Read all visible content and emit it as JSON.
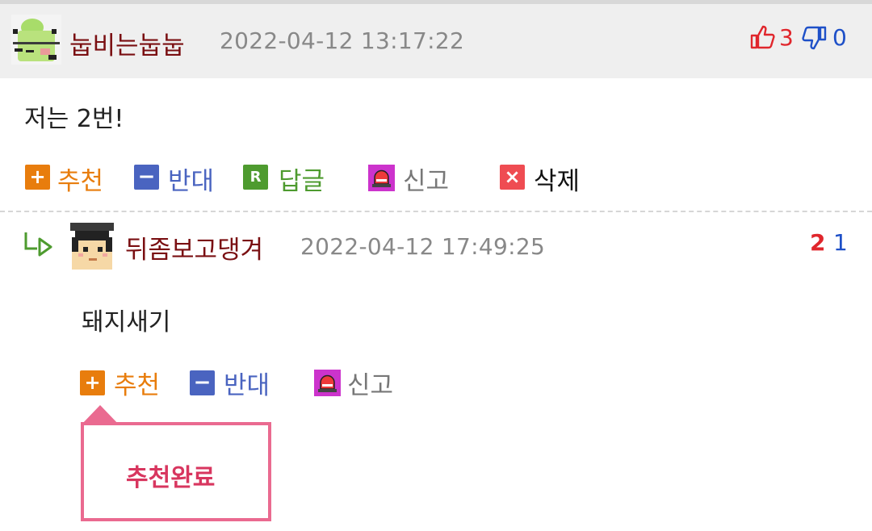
{
  "colors": {
    "nickname": "#7a0f12",
    "recommend_orange": "#e87d0d",
    "oppose_blue": "#4a64c0",
    "reply_green": "#4e9b2f",
    "report_magenta": "#cc33cc",
    "delete_red": "#ef4c52",
    "tooltip_pink": "#ea6a90",
    "tooltip_text": "#d8365f"
  },
  "comment": {
    "author": "눕비는눕눕",
    "datetime": "2022-04-12 13:17:22",
    "likes": "3",
    "dislikes": "0",
    "body": "저는 2번!",
    "actions": {
      "recommend": "추천",
      "oppose": "반대",
      "reply": "답글",
      "report": "신고",
      "delete": "삭제"
    },
    "icons": {
      "plus": "+",
      "minus": "−",
      "reply": "R",
      "delete": "×"
    }
  },
  "reply": {
    "author": "뒤좀보고댕겨",
    "datetime": "2022-04-12 17:49:25",
    "likes": "2",
    "dislikes": "1",
    "body": "돼지새기",
    "actions": {
      "recommend": "추천",
      "oppose": "반대",
      "report": "신고"
    },
    "icons": {
      "plus": "+",
      "minus": "−"
    }
  },
  "tooltip": {
    "text": "추천완료"
  }
}
